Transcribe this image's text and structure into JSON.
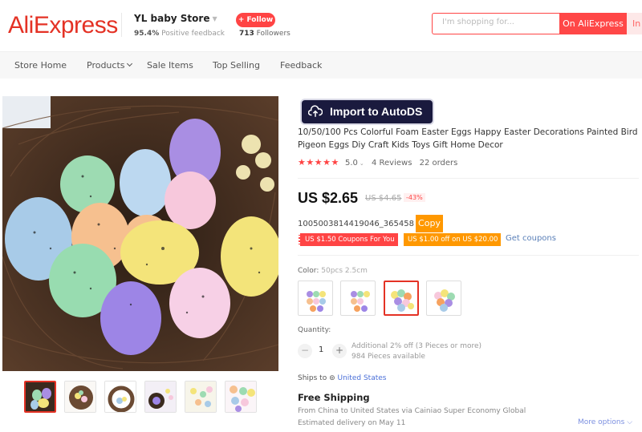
{
  "header": {
    "logo": "AliExpress",
    "store_name": "YL baby Store",
    "feedback_pct": "95.4%",
    "feedback_label": "Positive feedback",
    "follow_label": "+ Follow",
    "followers_count": "713",
    "followers_label": "Followers",
    "search_placeholder": "I'm shopping for...",
    "search_btn_primary": "On AliExpress",
    "search_btn_secondary": "In this store"
  },
  "nav": {
    "items": [
      {
        "label": "Store Home"
      },
      {
        "label": "Products"
      },
      {
        "label": "Sale Items"
      },
      {
        "label": "Top Selling"
      },
      {
        "label": "Feedback"
      }
    ]
  },
  "gallery": {
    "thumbnail_count": 6,
    "active_index": 0
  },
  "product": {
    "import_button": "Import to AutoDS",
    "title": "10/50/100 Pcs Colorful Foam Easter Eggs Happy Easter Decorations Painted Bird Pigeon Eggs Diy Craft Kids Toys Gift Home Decor",
    "stars": "★★★★★",
    "rating": "5.0",
    "reviews": "4 Reviews",
    "orders": "22 orders",
    "price": "US $2.65",
    "original_price": "US $4.65",
    "discount": "-43%",
    "sku": "1005003814419046_365458",
    "copy_label": "Copy",
    "coupon_store": "US $1.50 Coupons For You",
    "coupon_select": "US $1.00 off on US $20.00",
    "get_coupons": "Get coupons",
    "color_label": "Color:",
    "color_value": "50pcs 2.5cm",
    "color_options_count": 4,
    "color_selected_index": 2,
    "quantity_label": "Quantity:",
    "quantity_value": "1",
    "qty_minus": "−",
    "qty_plus": "+",
    "quantity_discount": "Additional 2% off (3 Pieces or more)",
    "available": "984 Pieces available",
    "ships_to_label": "Ships to",
    "ships_to_country": "United States",
    "shipping_title": "Free Shipping",
    "shipping_route": "From China to United States via Cainiao Super Economy Global",
    "delivery": "Estimated delivery on May 11",
    "more_options": "More options"
  },
  "colors": {
    "brand": "#e43225",
    "accent_red": "#ff4747",
    "coupon_orange": "#ff9800",
    "link_blue": "#5a7fb8",
    "autods_navy": "#1a1a3e"
  }
}
